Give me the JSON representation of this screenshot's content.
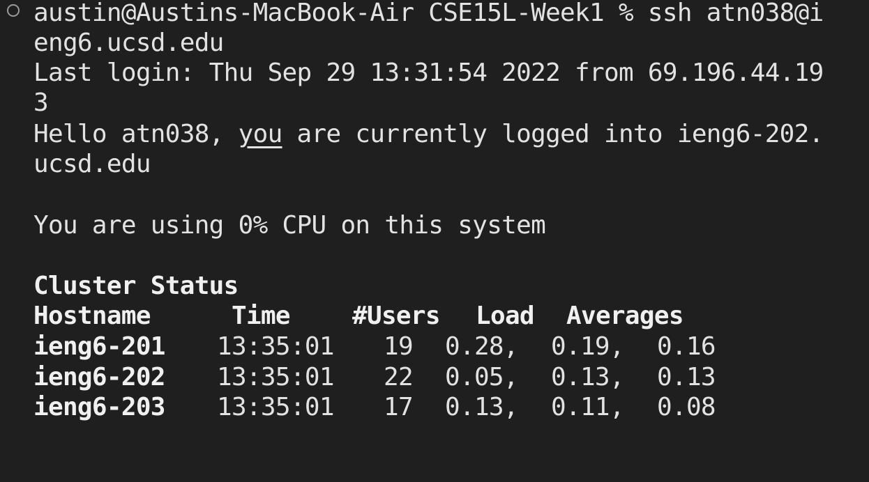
{
  "terminal": {
    "prompt_line1": "austin@Austins-MacBook-Air CSE15L-Week1 % ssh atn038@i",
    "prompt_line2": "eng6.ucsd.edu",
    "last_login_line1": "Last login: Thu Sep 29 13:31:54 2022 from 69.196.44.19",
    "last_login_line2": "3",
    "hello_prefix": "Hello atn038, ",
    "hello_you": "you",
    "hello_suffix": " are currently logged into ieng6-202.",
    "hello_line2": "ucsd.edu",
    "cpu_line": "You are using 0% CPU on this system",
    "cluster_title": "Cluster Status",
    "headers": [
      "Hostname",
      "Time",
      "#Users",
      "Load",
      "Averages"
    ],
    "rows": [
      {
        "host": "ieng6-201",
        "time": "13:35:01",
        "users": "19",
        "l1": "0.28,",
        "l2": "0.19,",
        "l3": "0.16"
      },
      {
        "host": "ieng6-202",
        "time": "13:35:01",
        "users": "22",
        "l1": "0.05,",
        "l2": "0.13,",
        "l3": "0.13"
      },
      {
        "host": "ieng6-203",
        "time": "13:35:01",
        "users": "17",
        "l1": "0.13,",
        "l2": "0.11,",
        "l3": "0.08"
      }
    ]
  }
}
